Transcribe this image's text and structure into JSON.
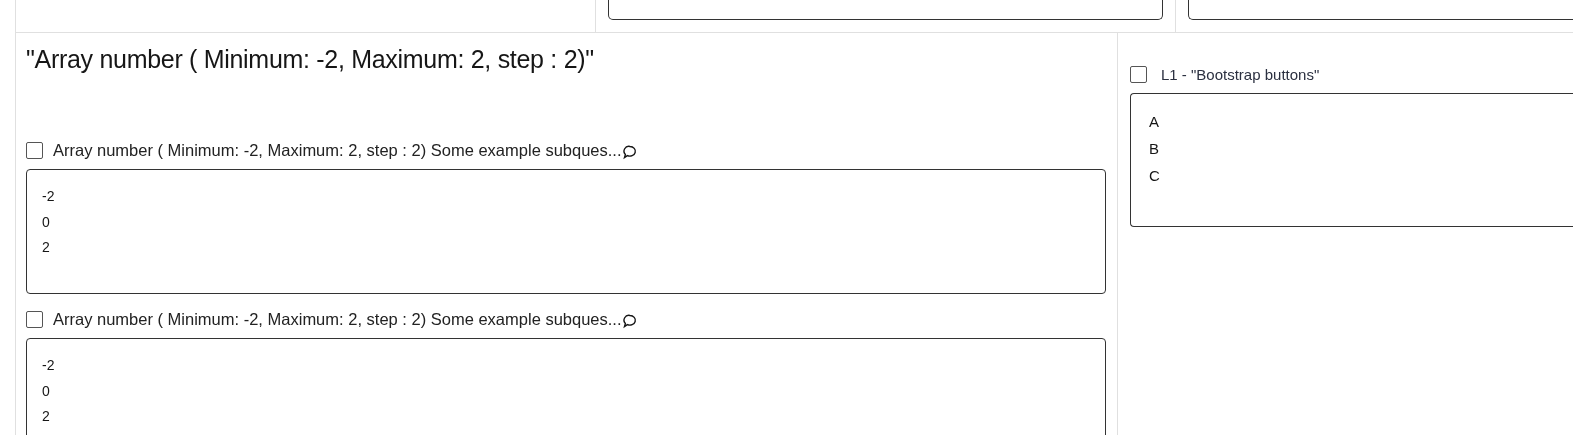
{
  "question": {
    "title": "\"Array number ( Minimum: -2, Maximum: 2, step : 2)\"",
    "subquestions": [
      {
        "label": "Array number ( Minimum: -2, Maximum: 2, step : 2) Some example subques...",
        "checked": false,
        "answers": [
          "-2",
          "0",
          "2"
        ]
      },
      {
        "label": "Array number ( Minimum: -2, Maximum: 2, step : 2) Some example subques...",
        "checked": false,
        "answers": [
          "-2",
          "0",
          "2"
        ]
      }
    ]
  },
  "side": {
    "label": "L1 - \"Bootstrap buttons\"",
    "checked": false,
    "answers": [
      "A",
      "B",
      "C"
    ]
  }
}
